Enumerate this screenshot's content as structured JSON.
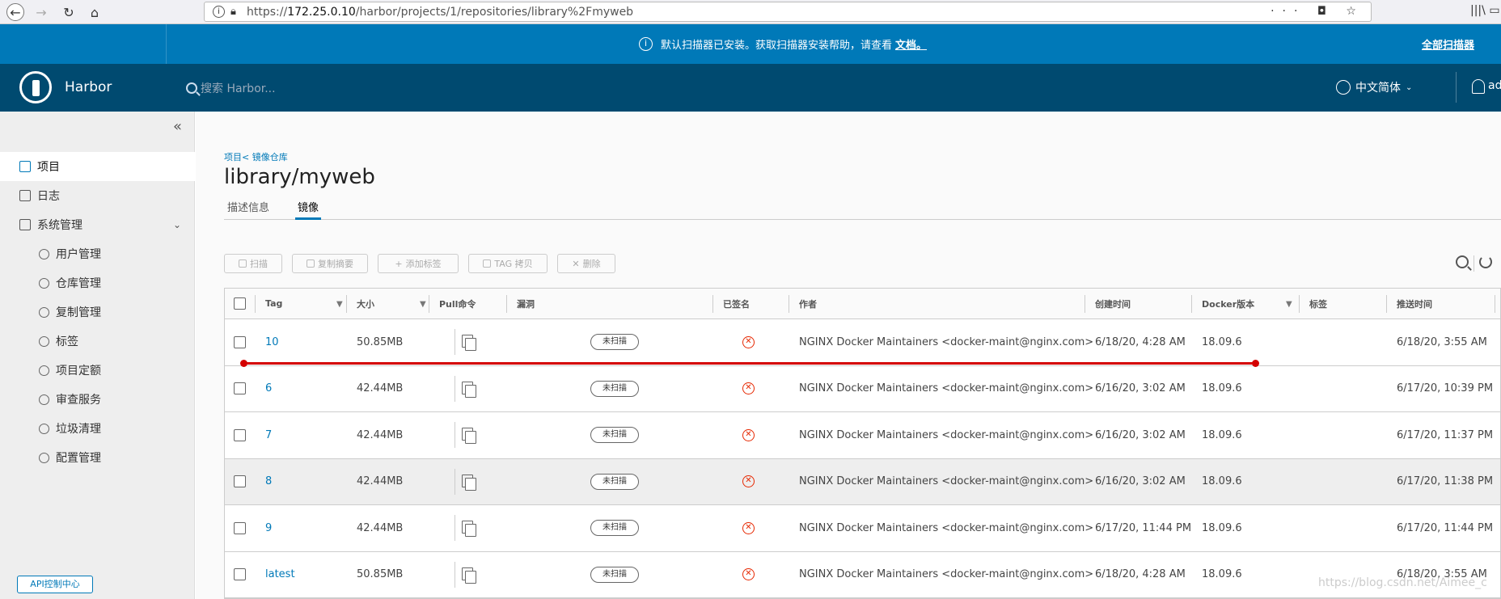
{
  "browser": {
    "url_prefix": "https://",
    "url_host": "172.25.0.10",
    "url_path": "/harbor/projects/1/repositories/library%2Fmyweb",
    "url_right_icons": "··· ◘ ☆"
  },
  "banner": {
    "message": "默认扫描器已安装。获取扫描器安装帮助，请查看",
    "doc_link": "文档。",
    "right_link": "全部扫描器"
  },
  "header": {
    "brand": "Harbor",
    "search_placeholder": "搜索 Harbor...",
    "language": "中文简体",
    "user": "ad"
  },
  "sidebar": {
    "items": [
      {
        "label": "项目",
        "icon": "projects-icon"
      },
      {
        "label": "日志",
        "icon": "log-icon"
      },
      {
        "label": "系统管理",
        "icon": "admin-icon"
      }
    ],
    "sub_items": [
      {
        "label": "用户管理",
        "icon": "users-icon"
      },
      {
        "label": "仓库管理",
        "icon": "registry-icon"
      },
      {
        "label": "复制管理",
        "icon": "replication-icon"
      },
      {
        "label": "标签",
        "icon": "tag-icon"
      },
      {
        "label": "项目定额",
        "icon": "quota-icon"
      },
      {
        "label": "审查服务",
        "icon": "shield-icon"
      },
      {
        "label": "垃圾清理",
        "icon": "trash-icon"
      },
      {
        "label": "配置管理",
        "icon": "gear-icon"
      }
    ],
    "api_button": "API控制中心"
  },
  "main": {
    "breadcrumb": "项目< 镜像仓库",
    "title": "library/myweb",
    "tabs": [
      "描述信息",
      "镜像"
    ],
    "toolbar": [
      "扫描",
      "复制摘要",
      "添加标签",
      "TAG 拷贝",
      "删除"
    ]
  },
  "table": {
    "headers": [
      "Tag",
      "大小",
      "Pull命令",
      "漏洞",
      "已签名",
      "作者",
      "创建时间",
      "Docker版本",
      "标签",
      "推送时间"
    ],
    "rows": [
      {
        "tag": "10",
        "size": "50.85MB",
        "vuln": "未扫描",
        "author": "NGINX Docker Maintainers <docker-maint@nginx.com>",
        "created": "6/18/20, 4:28 AM",
        "docker": "18.09.6",
        "pushed": "6/18/20, 3:55 AM"
      },
      {
        "tag": "6",
        "size": "42.44MB",
        "vuln": "未扫描",
        "author": "NGINX Docker Maintainers <docker-maint@nginx.com>",
        "created": "6/16/20, 3:02 AM",
        "docker": "18.09.6",
        "pushed": "6/17/20, 10:39 PM"
      },
      {
        "tag": "7",
        "size": "42.44MB",
        "vuln": "未扫描",
        "author": "NGINX Docker Maintainers <docker-maint@nginx.com>",
        "created": "6/16/20, 3:02 AM",
        "docker": "18.09.6",
        "pushed": "6/17/20, 11:37 PM"
      },
      {
        "tag": "8",
        "size": "42.44MB",
        "vuln": "未扫描",
        "author": "NGINX Docker Maintainers <docker-maint@nginx.com>",
        "created": "6/16/20, 3:02 AM",
        "docker": "18.09.6",
        "pushed": "6/17/20, 11:38 PM"
      },
      {
        "tag": "9",
        "size": "42.44MB",
        "vuln": "未扫描",
        "author": "NGINX Docker Maintainers <docker-maint@nginx.com>",
        "created": "6/17/20, 11:44 PM",
        "docker": "18.09.6",
        "pushed": "6/17/20, 11:44 PM"
      },
      {
        "tag": "latest",
        "size": "50.85MB",
        "vuln": "未扫描",
        "author": "NGINX Docker Maintainers <docker-maint@nginx.com>",
        "created": "6/18/20, 4:28 AM",
        "docker": "18.09.6",
        "pushed": "6/18/20, 3:55 AM"
      }
    ]
  },
  "watermark": "https://blog.csdn.net/Aimee_c"
}
